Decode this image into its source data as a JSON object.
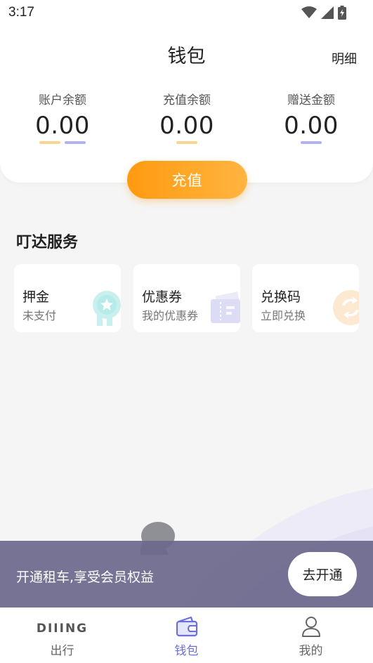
{
  "status_bar": {
    "time": "3:17",
    "icons": [
      "wifi-icon",
      "signal-icon",
      "battery-charging-icon"
    ]
  },
  "header": {
    "title": "钱包",
    "detail_link": "明细"
  },
  "balances": [
    {
      "label": "账户余额",
      "value": "0.00",
      "bar_colors": [
        "#fcd690",
        "#b3b2f0"
      ]
    },
    {
      "label": "充值余额",
      "value": "0.00",
      "bar_colors": [
        "#fcd690"
      ]
    },
    {
      "label": "赠送金额",
      "value": "0.00",
      "bar_colors": [
        "#b3b2f0"
      ]
    }
  ],
  "recharge_button": "充值",
  "services": {
    "title": "叮达服务",
    "items": [
      {
        "title": "押金",
        "subtitle": "未支付",
        "icon": "badge-star-icon"
      },
      {
        "title": "优惠券",
        "subtitle": "我的优惠券",
        "icon": "coupon-icon"
      },
      {
        "title": "兑换码",
        "subtitle": "立即兑换",
        "icon": "exchange-icon"
      }
    ]
  },
  "member_banner": {
    "text": "开通租车,享受会员权益",
    "button": "去开通"
  },
  "tab_bar": {
    "logo_text": "DIIING",
    "tabs": [
      {
        "label": "出行",
        "active": false
      },
      {
        "label": "钱包",
        "active": true
      },
      {
        "label": "我的",
        "active": false
      }
    ]
  },
  "colors": {
    "accent_orange": "#ff9a10",
    "accent_purple": "#6b6fd8",
    "banner_bg": "#6c688c"
  }
}
